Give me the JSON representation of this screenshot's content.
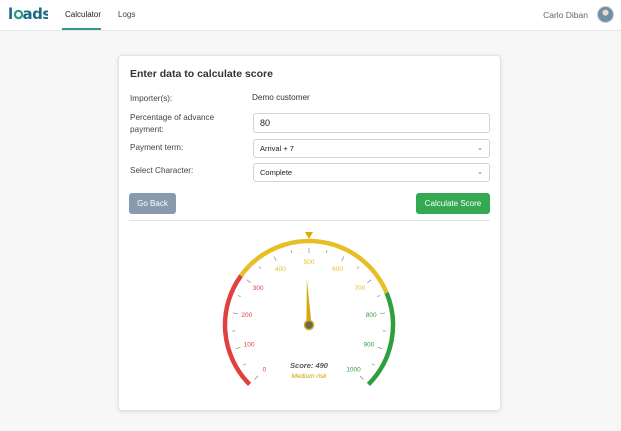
{
  "header": {
    "brand": "loads",
    "tabs": [
      {
        "label": "Calculator",
        "active": true
      },
      {
        "label": "Logs",
        "active": false
      }
    ],
    "user_name": "Carlo Diban"
  },
  "form": {
    "title": "Enter data to calculate score",
    "importer_label": "Importer(s):",
    "importer_value": "Demo customer",
    "advance_label": "Percentage of advance payment:",
    "advance_value": "80",
    "payment_term_label": "Payment term:",
    "payment_term_value": "Arrival + 7",
    "character_label": "Select Character:",
    "character_value": "Complete",
    "back_label": "Go Back",
    "calc_label": "Calculate Score"
  },
  "gauge": {
    "min": 0,
    "max": 1000,
    "ticks": [
      0,
      100,
      200,
      300,
      400,
      500,
      600,
      700,
      800,
      900,
      1000
    ],
    "score": 490,
    "score_text": "Score: 490",
    "risk_text": "Medium risk",
    "segments": [
      {
        "from": 0,
        "to": 300,
        "color": "#e04040"
      },
      {
        "from": 300,
        "to": 750,
        "color": "#e6bf26"
      },
      {
        "from": 750,
        "to": 1000,
        "color": "#2e9e40"
      }
    ],
    "needle_color": "#d5aa10",
    "pointer_color": "#e0a800"
  }
}
